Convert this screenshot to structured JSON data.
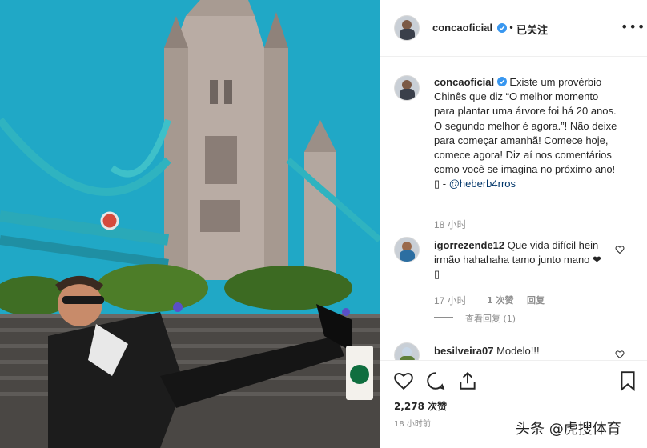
{
  "post": {
    "username": "concaoficial",
    "follow_status": "已关注",
    "separator": "•",
    "more": "•••"
  },
  "caption": {
    "username": "concaoficial",
    "text": "Existe um provérbio Chinês que diz “O melhor momento para plantar uma árvore foi há 20 anos. O segundo melhor é agora.”! Não deixe para começar amanhã! Comece hoje, comece agora! Diz aí nos comentários como você se imagina no próximo ano!",
    "credit_prefix": "▯ - ",
    "credit_mention": "@heberb4rros",
    "time": "18 小时"
  },
  "comments": [
    {
      "username": "igorrezende12",
      "text": "Que vida difícil hein irmão hahahaha tamo junto mano ❤▯",
      "time": "17 小时",
      "likes": "1 次赞",
      "reply": "回复",
      "view_replies": "查看回复 (1)"
    },
    {
      "username": "besilveira07",
      "text": "Modelo!!!"
    }
  ],
  "actions": {
    "like_count": "2,278 次赞",
    "time_ago": "18 小时前"
  },
  "watermark": "头条 @虎搜体育",
  "colors": {
    "sky": "#1fa7c4",
    "verified": "#3897f0",
    "link": "#003569",
    "muted": "#8e8e8e"
  }
}
